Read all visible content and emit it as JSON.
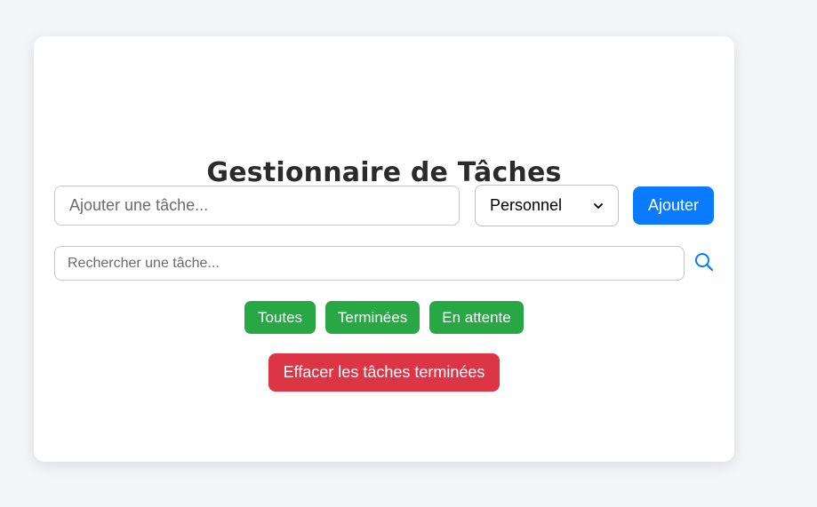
{
  "app": {
    "title": "Gestionnaire de Tâches"
  },
  "task_form": {
    "input_placeholder": "Ajouter une tâche...",
    "input_value": "",
    "category_selected": "Personnel",
    "add_label": "Ajouter"
  },
  "search": {
    "placeholder": "Rechercher une tâche...",
    "value": "",
    "icon": "search-icon"
  },
  "filters": [
    {
      "label": "Toutes"
    },
    {
      "label": "Terminées"
    },
    {
      "label": "En attente"
    }
  ],
  "actions": {
    "clear_completed_label": "Effacer les tâches terminées"
  },
  "colors": {
    "primary": "#0a7bff",
    "success": "#28a745",
    "danger": "#dc3545",
    "background": "#f4f5f9",
    "card": "#ffffff"
  }
}
